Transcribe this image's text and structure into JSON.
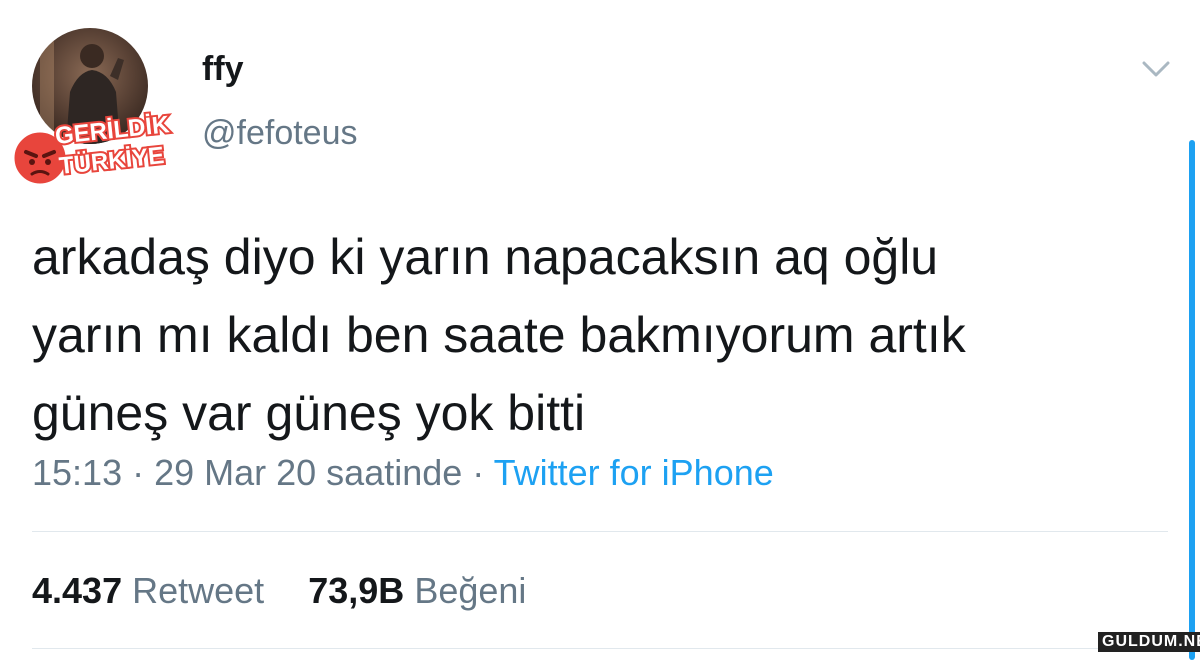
{
  "user": {
    "display_name": "ffy",
    "handle": "@fefoteus"
  },
  "tweet": {
    "lines": [
      "arkadaş diyo ki yarın napacaksın aq oğlu",
      "yarın mı kaldı ben saate bakmıyorum artık",
      "güneş var güneş yok bitti"
    ]
  },
  "meta": {
    "time": "15:13",
    "sep1": " · ",
    "date": "29 Mar 20 saatinde",
    "sep2": " · ",
    "source": "Twitter for iPhone"
  },
  "stats": {
    "retweets_count": "4.437",
    "retweets_label": "Retweet",
    "likes_count": "73,9B",
    "likes_label": "Beğeni"
  },
  "watermark": {
    "line1": "GERİLDİK",
    "line2": "TÜRKİYE"
  },
  "site_mark": "GULDUM.NET",
  "colors": {
    "accent": "#1da1f2",
    "secondary_text": "#657786",
    "primary_text": "#14171a"
  },
  "icons": {
    "chevron": "chevron-down-icon",
    "badge_face": "angry-face-icon"
  }
}
